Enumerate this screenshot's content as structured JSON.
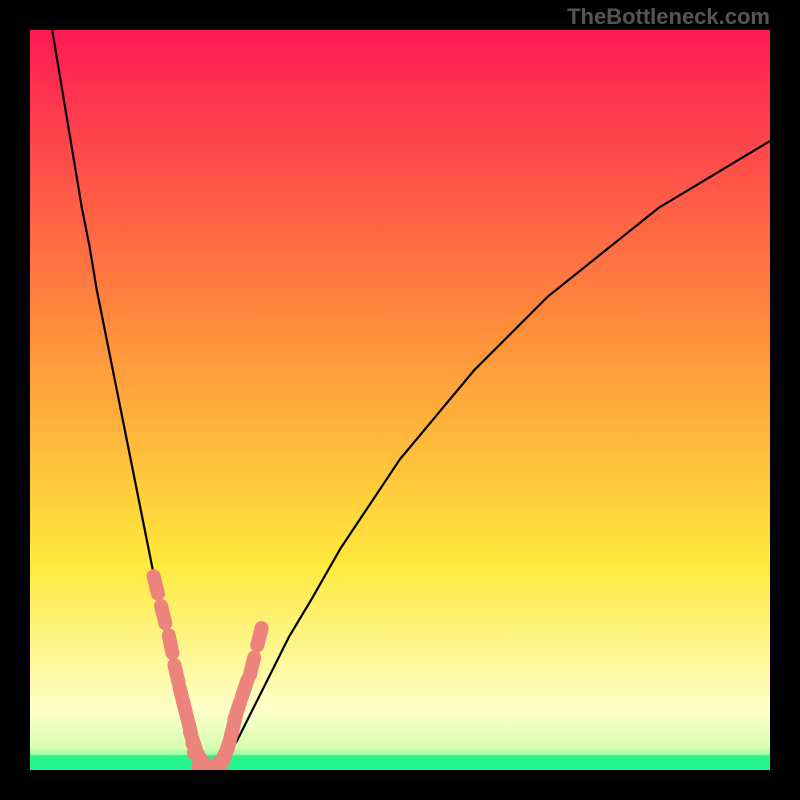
{
  "watermark": "TheBottleneck.com",
  "colors": {
    "frame": "#000000",
    "curve": "#000000",
    "marker": "#ec837c",
    "green_band": "#25f58c",
    "gradient_top": "#ff1a55",
    "gradient_mid1": "#ff8c3c",
    "gradient_mid2": "#ffe93c",
    "gradient_pale": "#feffc8"
  },
  "chart_data": {
    "type": "line",
    "title": "",
    "xlabel": "",
    "ylabel": "",
    "xlim": [
      0,
      100
    ],
    "ylim": [
      0,
      100
    ],
    "curve": {
      "name": "bottleneck-curve",
      "x": [
        3,
        4,
        5,
        6,
        7,
        8,
        9,
        10,
        11,
        12,
        13,
        14,
        15,
        16,
        17,
        18,
        19,
        20,
        21,
        22,
        23,
        24,
        25,
        26,
        28,
        30,
        32,
        35,
        38,
        42,
        46,
        50,
        55,
        60,
        65,
        70,
        75,
        80,
        85,
        90,
        95,
        100
      ],
      "y": [
        100,
        94,
        88,
        82,
        76,
        71,
        65,
        60,
        55,
        50,
        45,
        40,
        35,
        30,
        25,
        20,
        15,
        10,
        6,
        3,
        1,
        0,
        0,
        1,
        4,
        8,
        12,
        18,
        23,
        30,
        36,
        42,
        48,
        54,
        59,
        64,
        68,
        72,
        76,
        79,
        82,
        85
      ]
    },
    "markers": {
      "name": "highlighted-points",
      "x": [
        17,
        18,
        19,
        19.8,
        20.5,
        21,
        21.5,
        22,
        22.5,
        23,
        23.5,
        24,
        24.5,
        25,
        25.5,
        26,
        26.5,
        27,
        27.5,
        28,
        29,
        30,
        31
      ],
      "y": [
        25,
        21,
        17,
        13,
        10,
        8,
        6,
        4,
        2.5,
        1.5,
        1,
        0.5,
        0.5,
        0.5,
        1,
        1.5,
        2.5,
        4,
        6,
        8,
        11,
        14,
        18
      ]
    },
    "green_band_y": [
      0,
      2
    ]
  }
}
